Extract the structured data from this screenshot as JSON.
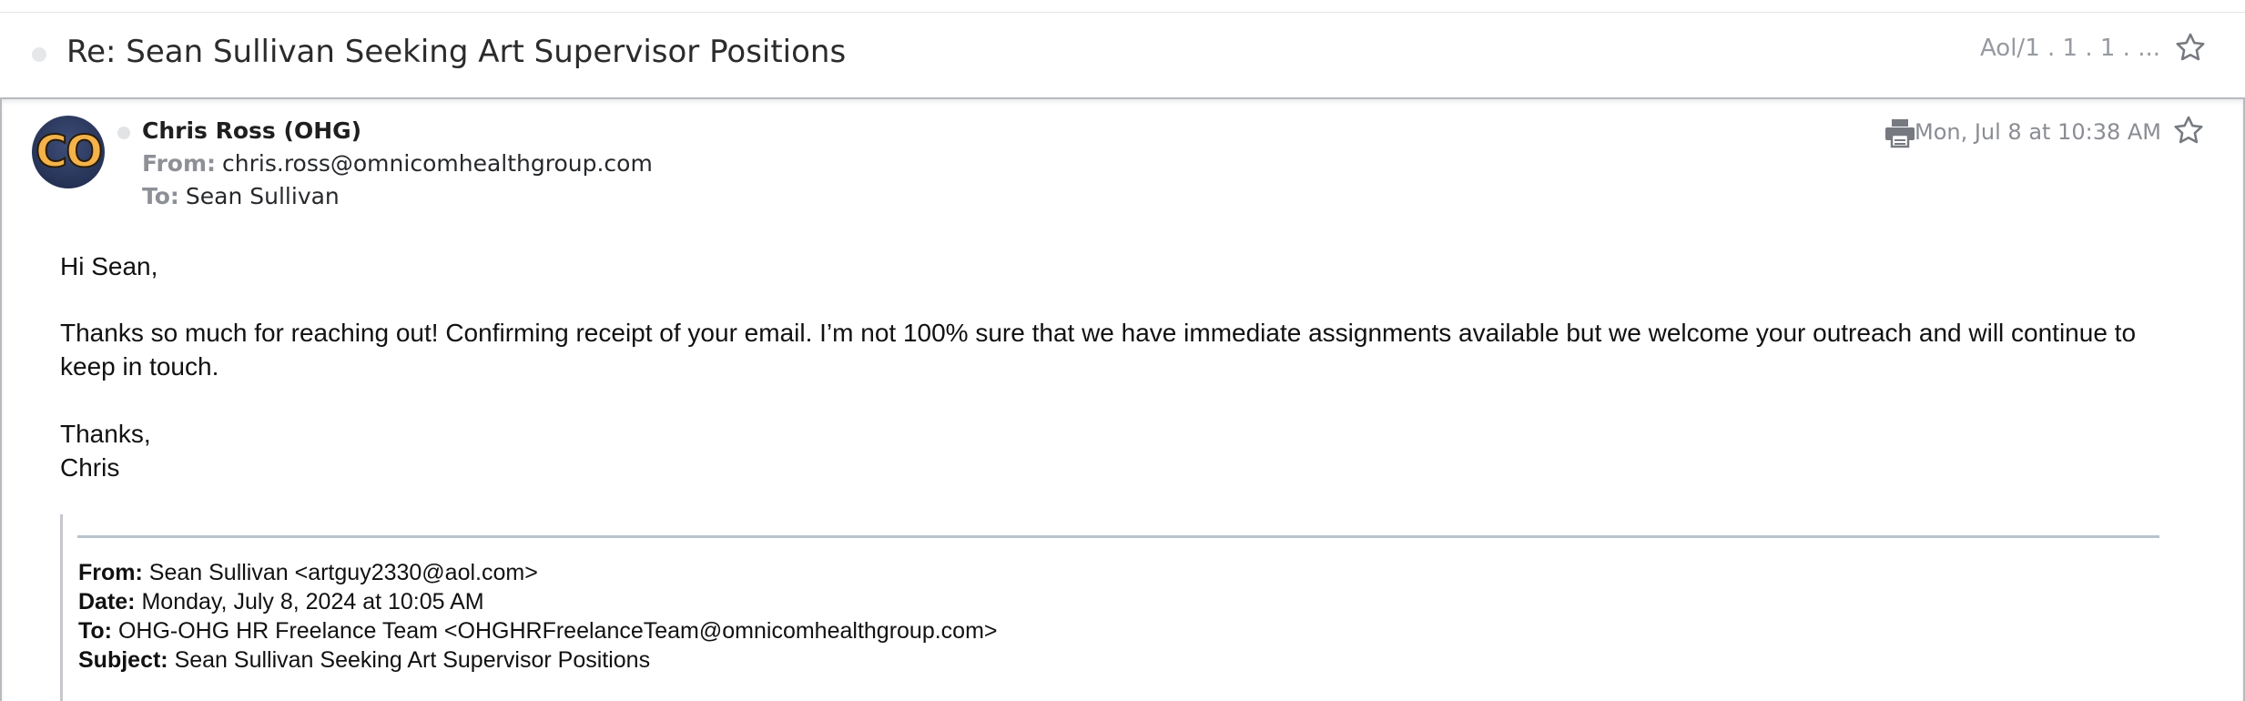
{
  "thread": {
    "subject": "Re: Sean Sullivan Seeking Art Supervisor Positions",
    "folder": "Aol/1 . 1 . 1 . ..."
  },
  "message": {
    "avatar_initials": "CO",
    "sender_name": "Chris Ross (OHG)",
    "from_label": "From:",
    "from_email": "chris.ross@omnicomhealthgroup.com",
    "to_label": "To:",
    "to_name": "Sean Sullivan",
    "date": "Mon, Jul 8 at 10:38 AM",
    "body": {
      "greeting": "Hi Sean,",
      "paragraph": "Thanks so much for reaching out!  Confirming receipt of your email.  I’m not 100% sure that we have immediate assignments available but we welcome your outreach and will continue to keep in touch.",
      "signoff": "Thanks,",
      "signature": "Chris"
    },
    "quoted": {
      "from_label": "From:",
      "from_value": "Sean Sullivan <artguy2330@aol.com>",
      "date_label": "Date:",
      "date_value": "Monday, July 8, 2024 at 10:05 AM",
      "to_label": "To:",
      "to_value": "OHG-OHG HR Freelance Team <OHGHRFreelanceTeam@omnicomhealthgroup.com>",
      "subject_label": "Subject:",
      "subject_value": "Sean Sullivan Seeking Art Supervisor Positions"
    }
  },
  "icons": {
    "thread_star": "star-outline-icon",
    "message_star": "star-outline-icon",
    "print": "printer-icon"
  },
  "colors": {
    "muted_text": "#8a8d93",
    "icon": "#767a80",
    "quote_rule": "#b9c3cc"
  }
}
